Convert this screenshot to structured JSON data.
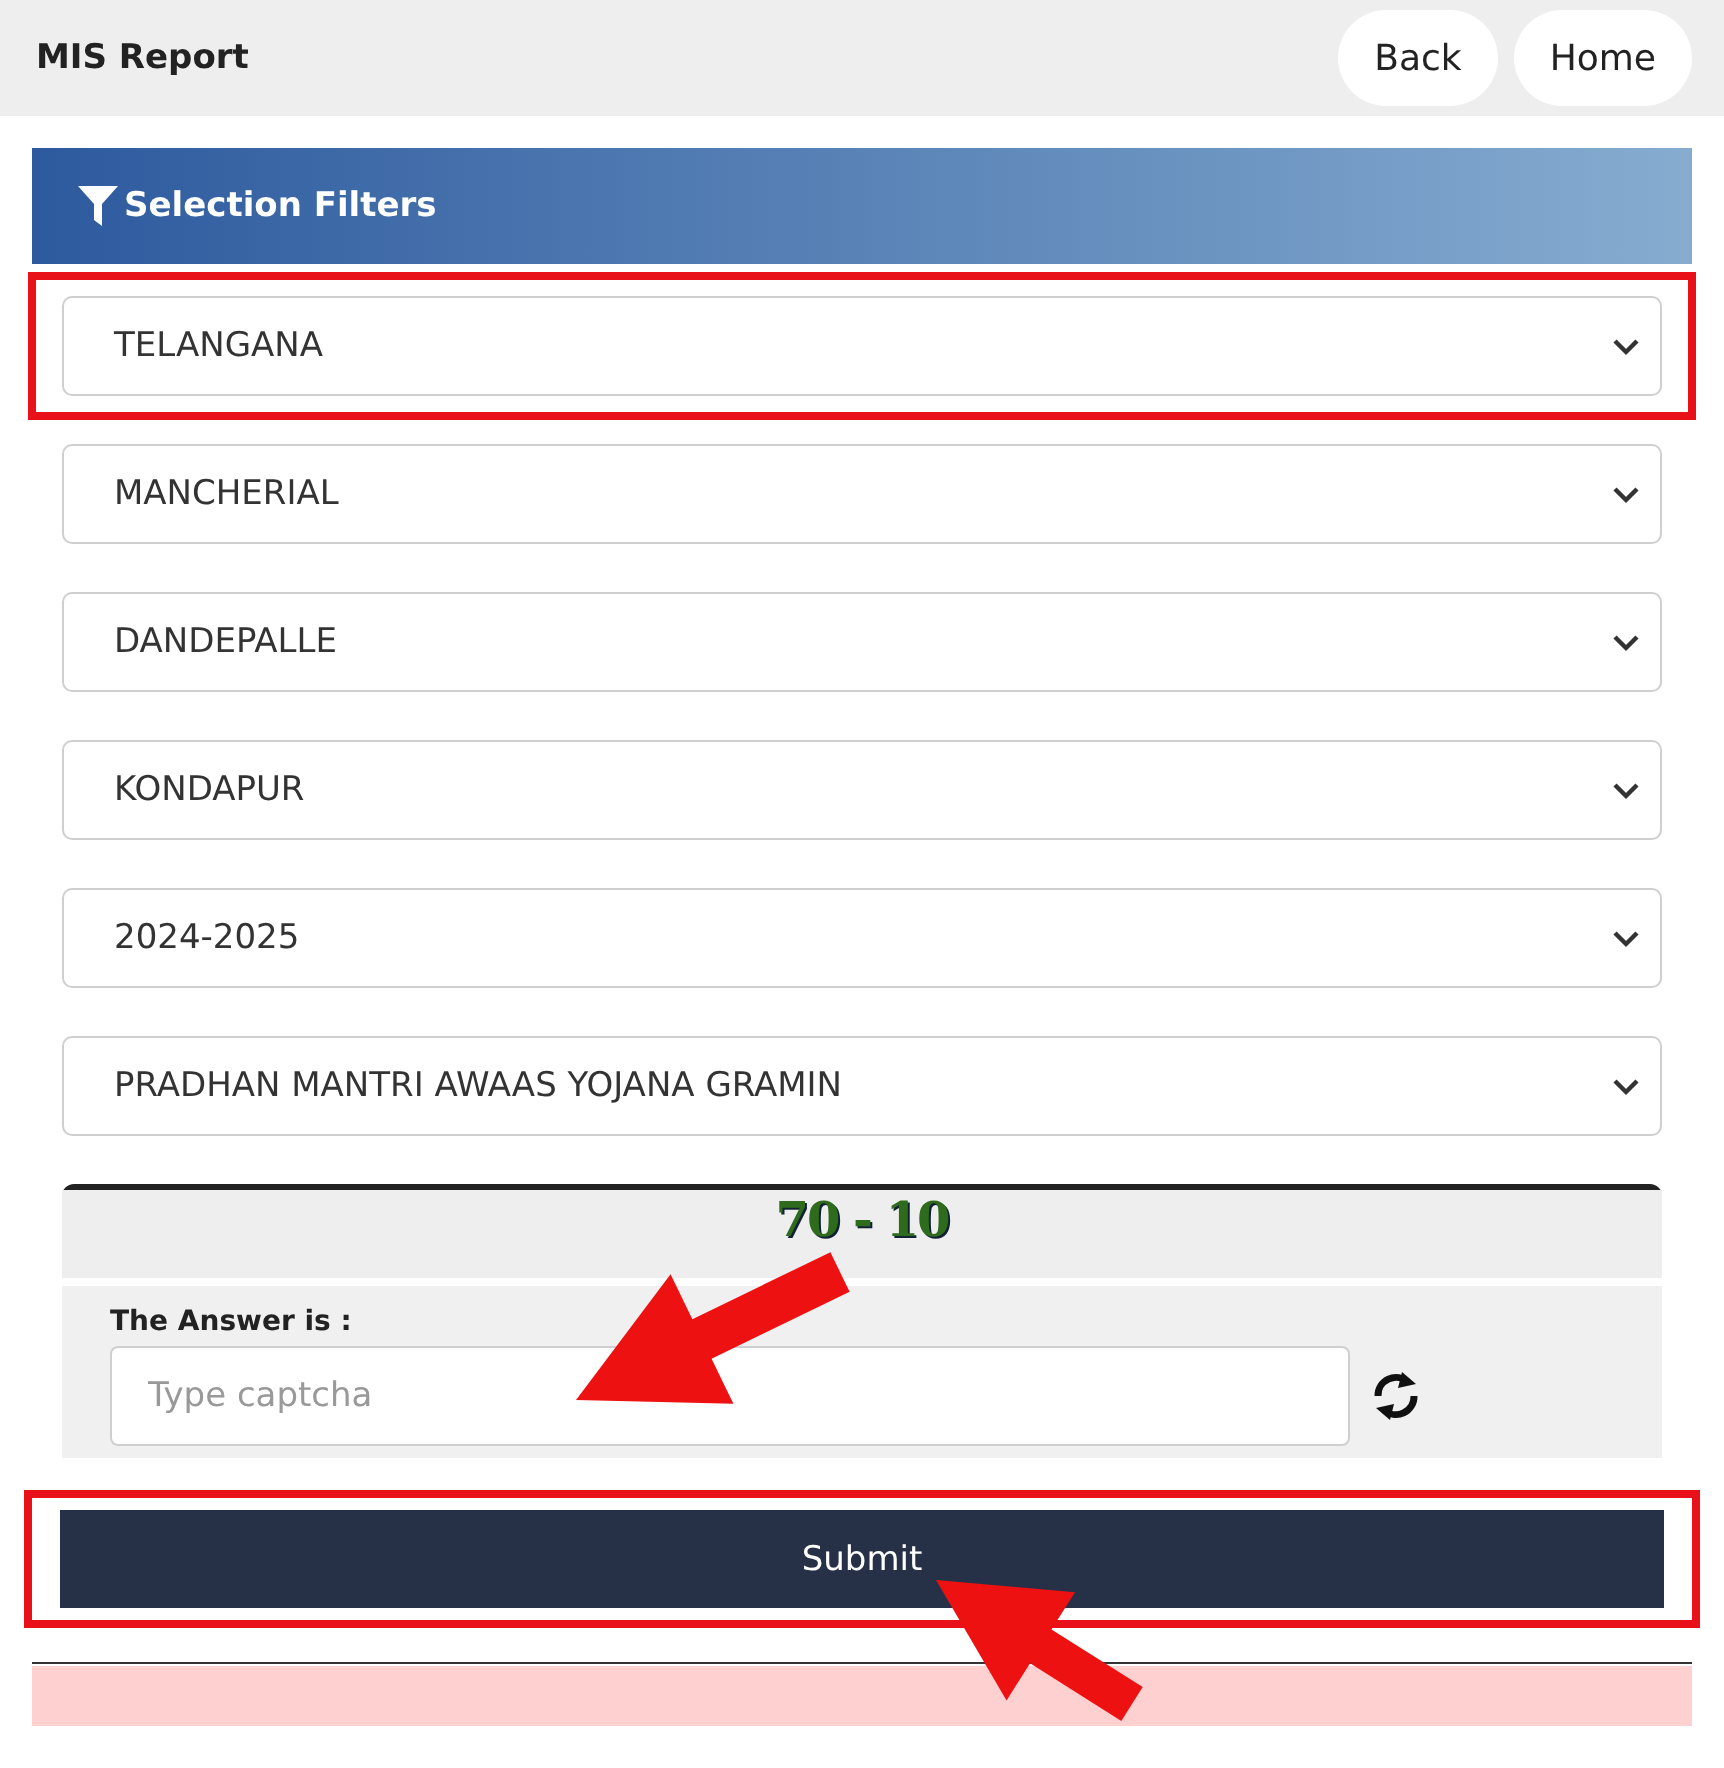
{
  "header": {
    "title": "MIS Report",
    "buttons": [
      "Back",
      "Home"
    ]
  },
  "filters": {
    "title": "Selection Filters",
    "dropdowns": [
      {
        "value": "TELANGANA",
        "highlighted": true
      },
      {
        "value": "MANCHERIAL",
        "highlighted": false
      },
      {
        "value": "DANDEPALLE",
        "highlighted": false
      },
      {
        "value": "KONDAPUR",
        "highlighted": false
      },
      {
        "value": "2024-2025",
        "highlighted": false
      },
      {
        "value": "PRADHAN MANTRI AWAAS YOJANA GRAMIN",
        "highlighted": false
      }
    ]
  },
  "captcha": {
    "question": "70 - 10",
    "label": "The Answer is :",
    "placeholder": "Type captcha"
  },
  "submit": {
    "label": "Submit",
    "highlighted": true
  }
}
